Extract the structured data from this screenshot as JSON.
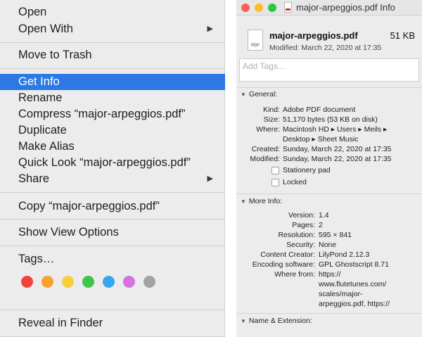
{
  "menu": {
    "items": {
      "open": "Open",
      "open_with": "Open With",
      "move_to_trash": "Move to Trash",
      "get_info": "Get Info",
      "rename": "Rename",
      "compress": "Compress “major-arpeggios.pdf”",
      "duplicate": "Duplicate",
      "make_alias": "Make Alias",
      "quick_look": "Quick Look “major-arpeggios.pdf”",
      "share": "Share",
      "copy": "Copy “major-arpeggios.pdf”",
      "show_view_options": "Show View Options",
      "tags": "Tags…",
      "reveal": "Reveal in Finder"
    },
    "submenu_arrow": "▶",
    "highlighted_item": "Get Info",
    "tag_colors": [
      "#f0443a",
      "#f6a12c",
      "#f7cf3a",
      "#3fc54a",
      "#36a7ef",
      "#d372e0",
      "#a3a3a7"
    ]
  },
  "info": {
    "window_title": "major-arpeggios.pdf Info",
    "traffic_lights": [
      "#fc5f57",
      "#fdbc2e",
      "#2ac840"
    ],
    "file_icon_label": "PDF",
    "file_name": "major-arpeggios.pdf",
    "file_size": "51 KB",
    "modified_line": "Modified: March 22, 2020 at 17:35",
    "tags_placeholder": "Add Tags...",
    "general": {
      "header": "General:",
      "disclosure": "▼",
      "kind_label": "Kind:",
      "kind_value": "Adobe PDF document",
      "size_label": "Size:",
      "size_value": "51,170 bytes (53 KB on disk)",
      "where_label": "Where:",
      "where_line1": "Macintosh HD ▸ Users ▸ Meils ▸",
      "where_line2": "Desktop ▸ Sheet Music",
      "created_label": "Created:",
      "created_value": "Sunday, March 22, 2020 at 17:35",
      "modified_label": "Modified:",
      "modified_value": "Sunday, March 22, 2020 at 17:35",
      "stationery_pad": "Stationery pad",
      "locked": "Locked"
    },
    "more_info": {
      "header": "More Info:",
      "disclosure": "▼",
      "version_label": "Version:",
      "version_value": "1.4",
      "pages_label": "Pages:",
      "pages_value": "2",
      "resolution_label": "Resolution:",
      "resolution_value": "595 × 841",
      "security_label": "Security:",
      "security_value": "None",
      "creator_label": "Content Creator:",
      "creator_value": "LilyPond 2.12.3",
      "encoding_label": "Encoding software:",
      "encoding_value": "GPL Ghostscript 8.71",
      "where_from_label": "Where from:",
      "where_from_lines": [
        "https://",
        "www.flutetunes.com/",
        "scales/major-",
        "arpeggios.pdf, https://"
      ]
    },
    "name_extension": {
      "header": "Name & Extension:",
      "disclosure": "▼"
    }
  }
}
